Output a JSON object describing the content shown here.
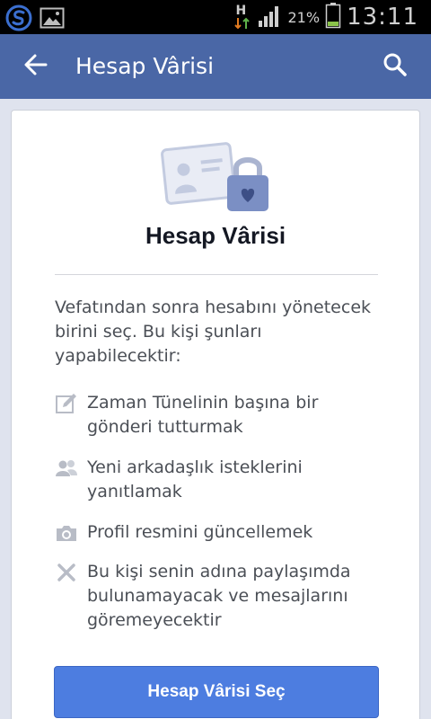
{
  "status_bar": {
    "battery_percent": "21%",
    "time": "13:11",
    "network_label": "H"
  },
  "app_bar": {
    "title": "Hesap Vârisi"
  },
  "card": {
    "title": "Hesap Vârisi",
    "intro": "Vefatından sonra hesabını yönetecek birini seç. Bu kişi şunları yapabilecektir:",
    "features": [
      {
        "icon": "edit-icon",
        "text": "Zaman Tünelinin başına bir gönderi tutturmak"
      },
      {
        "icon": "friends-icon",
        "text": "Yeni arkadaşlık isteklerini yanıtlamak"
      },
      {
        "icon": "camera-icon",
        "text": "Profil resmini güncellemek"
      },
      {
        "icon": "x-icon",
        "text": "Bu kişi senin adına paylaşımda bulunamayacak ve mesajlarını göremeyecektir"
      }
    ],
    "button_label": "Hesap Vârisi Seç"
  },
  "colors": {
    "app_bar": "#4a67a6",
    "button": "#4d7de0",
    "background": "#dfe3ee"
  }
}
